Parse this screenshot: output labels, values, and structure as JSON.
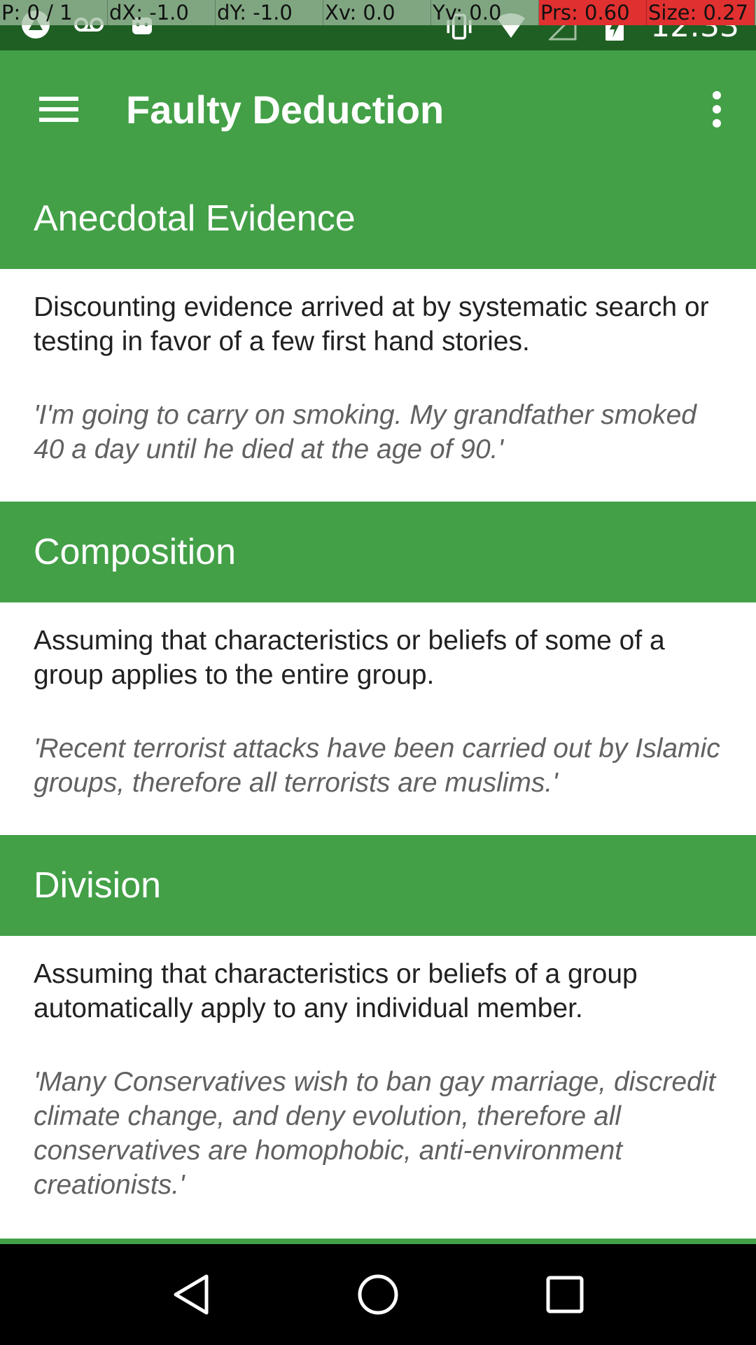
{
  "debug_overlay": {
    "pointer": "P: 0 / 1",
    "dx": "dX: -1.0",
    "dy": "dY: -1.0",
    "xv": "Xv: 0.0",
    "yv": "Yv: 0.0",
    "pressure": "Prs: 0.60",
    "size": "Size: 0.27"
  },
  "status_bar": {
    "time": "12:33",
    "icons": [
      "app-notification-icon",
      "voicemail-icon",
      "android-debug-icon",
      "vibrate-icon",
      "wifi-icon",
      "signal-icon",
      "battery-charging-icon"
    ]
  },
  "app_bar": {
    "title": "Faulty Deduction",
    "menu_icon": "hamburger-menu-icon",
    "overflow_icon": "more-vert-icon"
  },
  "fallacies": [
    {
      "name": "Anecdotal Evidence",
      "description": "Discounting evidence arrived at by systematic search or testing in favor of a few first hand stories.",
      "example": "'I'm going to carry on smoking. My grandfather smoked 40 a day until he died at the age of 90.'"
    },
    {
      "name": "Composition",
      "description": "Assuming that characteristics or beliefs of some of a group applies to the entire group.",
      "example": "'Recent terrorist attacks have been carried out by Islamic groups, therefore all terrorists are muslims.'"
    },
    {
      "name": "Division",
      "description": "Assuming that characteristics or beliefs of a group automatically apply to any individual member.",
      "example": "'Many Conservatives wish to ban gay marriage, discredit climate change, and deny evolution, therefore all conservatives are homophobic, anti-environment creationists.'"
    }
  ],
  "nav_bar": {
    "back_icon": "back-triangle-icon",
    "home_icon": "home-circle-icon",
    "recents_icon": "recents-square-icon"
  },
  "colors": {
    "primary": "#43a047",
    "primary_dark": "#1f5f24",
    "text": "#212121",
    "example_text": "#616161"
  }
}
